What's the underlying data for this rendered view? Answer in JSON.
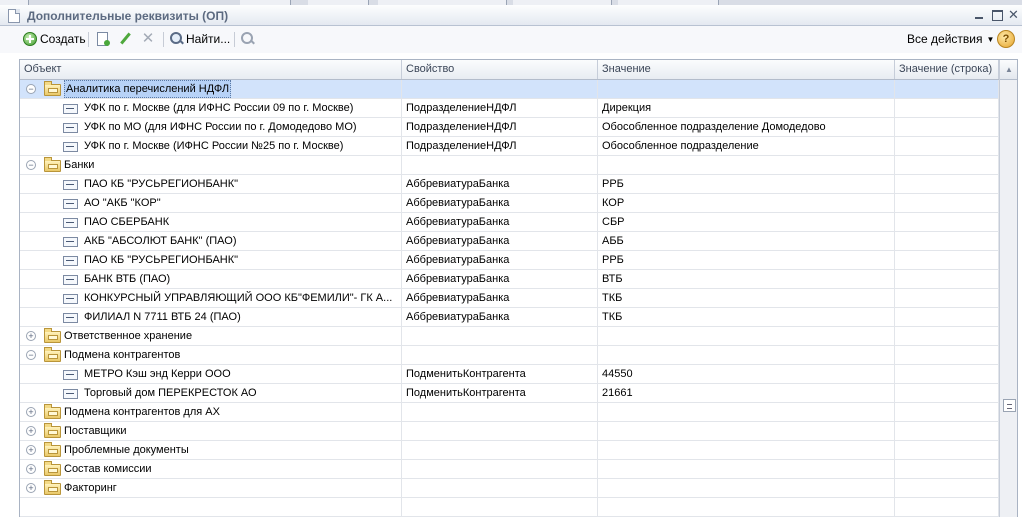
{
  "window": {
    "title": "Дополнительные реквизиты (ОП)"
  },
  "toolbar": {
    "create_label": "Создать",
    "find_label": "Найти...",
    "all_actions_label": "Все действия",
    "help_label": "?"
  },
  "grid": {
    "columns": [
      "Объект",
      "Свойство",
      "Значение",
      "Значение (строка)"
    ],
    "rows": [
      {
        "kind": "group",
        "object": "Аналитика перечислений НДФЛ",
        "property": "",
        "value": "",
        "value_str": "",
        "expanded": true,
        "selected": true
      },
      {
        "kind": "item",
        "object": "УФК по г. Москве (для ИФНС России 09 по г. Москве)",
        "property": "ПодразделениеНДФЛ",
        "value": "Дирекция",
        "value_str": ""
      },
      {
        "kind": "item",
        "object": "УФК по МО (для ИФНС России по г. Домодедово МО)",
        "property": "ПодразделениеНДФЛ",
        "value": "Обособленное подразделение Домодедово",
        "value_str": ""
      },
      {
        "kind": "item",
        "object": "УФК по г. Москве (ИФНС России №25 по г. Москве)",
        "property": "ПодразделениеНДФЛ",
        "value": "Обособленное подразделение",
        "value_str": ""
      },
      {
        "kind": "group",
        "object": "Банки",
        "property": "",
        "value": "",
        "value_str": "",
        "expanded": true
      },
      {
        "kind": "item",
        "object": "ПАО КБ \"РУСЬРЕГИОНБАНК\"",
        "property": "АббревиатураБанка",
        "value": "РРБ",
        "value_str": ""
      },
      {
        "kind": "item",
        "object": "АО \"АКБ \"КОР\"",
        "property": "АббревиатураБанка",
        "value": "КОР",
        "value_str": ""
      },
      {
        "kind": "item",
        "object": "ПАО СБЕРБАНК",
        "property": "АббревиатураБанка",
        "value": "СБР",
        "value_str": ""
      },
      {
        "kind": "item",
        "object": "АКБ \"АБСОЛЮТ БАНК\" (ПАО)",
        "property": "АббревиатураБанка",
        "value": "АББ",
        "value_str": ""
      },
      {
        "kind": "item",
        "object": "ПАО КБ \"РУСЬРЕГИОНБАНК\"",
        "property": "АббревиатураБанка",
        "value": "РРБ",
        "value_str": ""
      },
      {
        "kind": "item",
        "object": "БАНК ВТБ (ПАО)",
        "property": "АббревиатураБанка",
        "value": "ВТБ",
        "value_str": ""
      },
      {
        "kind": "item",
        "object": "КОНКУРСНЫЙ УПРАВЛЯЮЩИЙ ООО КБ\"ФЕМИЛИ\"- ГК А...",
        "property": "АббревиатураБанка",
        "value": "ТКБ",
        "value_str": ""
      },
      {
        "kind": "item",
        "object": "ФИЛИАЛ N 7711 ВТБ 24 (ПАО)",
        "property": "АббревиатураБанка",
        "value": "ТКБ",
        "value_str": ""
      },
      {
        "kind": "group",
        "object": "Ответственное хранение",
        "property": "",
        "value": "",
        "value_str": "",
        "expanded": false
      },
      {
        "kind": "group",
        "object": "Подмена контрагентов",
        "property": "",
        "value": "",
        "value_str": "",
        "expanded": true
      },
      {
        "kind": "item",
        "object": "МЕТРО Кэш энд Керри ООО",
        "property": "ПодменитьКонтрагента",
        "value": "44550",
        "value_str": ""
      },
      {
        "kind": "item",
        "object": "Торговый дом ПЕРЕКРЕСТОК АО",
        "property": "ПодменитьКонтрагента",
        "value": "21661",
        "value_str": ""
      },
      {
        "kind": "group",
        "object": "Подмена контрагентов для АХ",
        "property": "",
        "value": "",
        "value_str": "",
        "expanded": false
      },
      {
        "kind": "group",
        "object": "Поставщики",
        "property": "",
        "value": "",
        "value_str": "",
        "expanded": false
      },
      {
        "kind": "group",
        "object": "Проблемные документы",
        "property": "",
        "value": "",
        "value_str": "",
        "expanded": false
      },
      {
        "kind": "group",
        "object": "Состав комиссии",
        "property": "",
        "value": "",
        "value_str": "",
        "expanded": false
      },
      {
        "kind": "group",
        "object": "Факторинг",
        "property": "",
        "value": "",
        "value_str": "",
        "expanded": false
      }
    ]
  }
}
